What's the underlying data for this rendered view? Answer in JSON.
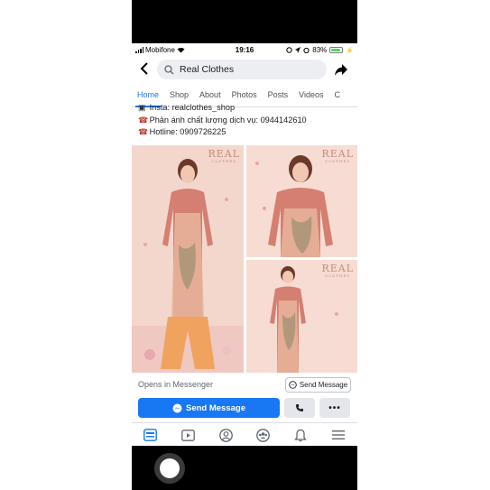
{
  "status_bar": {
    "carrier": "Mobifone",
    "time": "19:16",
    "battery": "83%"
  },
  "search": {
    "query": "Real Clothes"
  },
  "tabs": [
    {
      "label": "Home",
      "active": true
    },
    {
      "label": "Shop"
    },
    {
      "label": "About"
    },
    {
      "label": "Photos"
    },
    {
      "label": "Posts"
    },
    {
      "label": "Videos"
    },
    {
      "label": "C"
    }
  ],
  "info": {
    "insta": "Insta: realclothes_shop",
    "feedback": "Phản ánh chất lượng dịch vụ: 0944142610",
    "hotline": "Hotline: 0909726225"
  },
  "photos": {
    "brand": "REAL",
    "brand_sub": "CLOTHES"
  },
  "messenger": {
    "opens_label": "Opens in Messenger",
    "send_outline_label": "Send Message",
    "send_primary_label": "Send Message",
    "more_label": "•••"
  },
  "colors": {
    "accent": "#1877f2",
    "dress": "#d98777",
    "backdrop": "#f4d8cf"
  },
  "icons": {
    "nav": [
      "feed-icon",
      "watch-icon",
      "profile-icon",
      "groups-icon",
      "notifications-icon",
      "menu-icon"
    ]
  }
}
